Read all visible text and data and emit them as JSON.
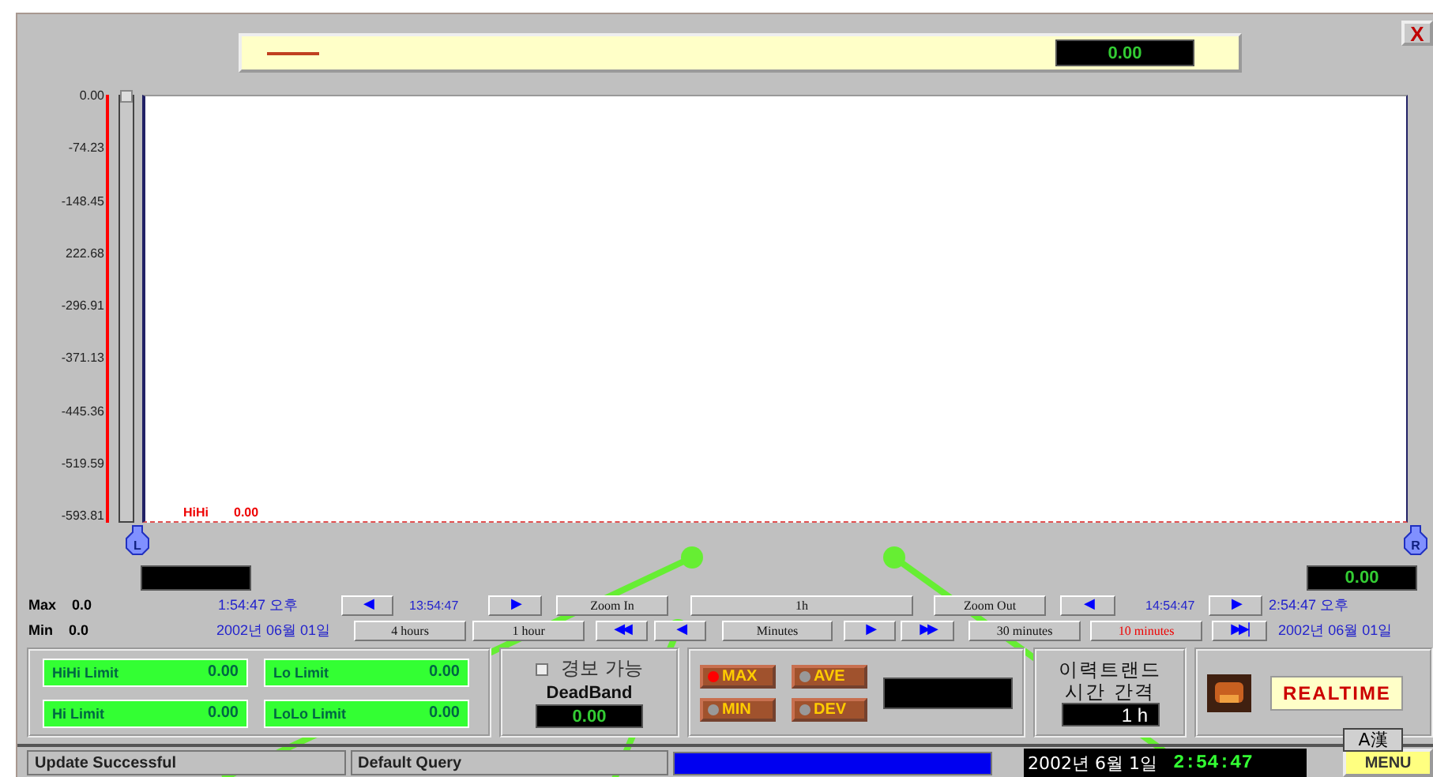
{
  "legend": {
    "value": "0.00"
  },
  "close_button": {
    "label": "X"
  },
  "y_axis": {
    "labels": [
      "0.00",
      "-74.23",
      "-148.45",
      "222.68",
      "-296.91",
      "-371.13",
      "-445.36",
      "-519.59",
      "-593.81"
    ]
  },
  "limit_line": {
    "label": "HiHi",
    "value": "0.00"
  },
  "cursors": [
    {
      "label": "L"
    },
    {
      "label": "R"
    }
  ],
  "cursor_value": "0.00",
  "summary": [
    {
      "label": "Max",
      "value": "0.0"
    },
    {
      "label": "Min",
      "value": "0.0"
    }
  ],
  "time_rows": [
    [
      {
        "kind": "text",
        "text": "1:54:47 오후"
      },
      {
        "kind": "nav",
        "text": "◀"
      },
      {
        "kind": "time",
        "text": "13:54:47"
      },
      {
        "kind": "nav",
        "text": "▶"
      },
      {
        "kind": "zoom",
        "text": "Zoom In"
      },
      {
        "kind": "zoom",
        "text": "1h"
      },
      {
        "kind": "zoom",
        "text": "Zoom Out"
      },
      {
        "kind": "nav",
        "text": "◀"
      },
      {
        "kind": "time",
        "text": "14:54:47"
      },
      {
        "kind": "nav",
        "text": "▶"
      },
      {
        "kind": "text",
        "text": "2:54:47 오후"
      }
    ],
    [
      {
        "kind": "text",
        "text": "2002년 06월 01일"
      },
      {
        "kind": "range",
        "text": "4 hours",
        "selected": false
      },
      {
        "kind": "range",
        "text": "1 hour",
        "selected": false
      },
      {
        "kind": "nav",
        "text": "◀◀"
      },
      {
        "kind": "nav",
        "text": "◀"
      },
      {
        "kind": "zoom",
        "text": "Minutes"
      },
      {
        "kind": "nav",
        "text": "▶"
      },
      {
        "kind": "nav",
        "text": "▶▶"
      },
      {
        "kind": "range",
        "text": "30 minutes",
        "selected": false
      },
      {
        "kind": "range",
        "text": "10 minutes",
        "selected": true
      },
      {
        "kind": "nav",
        "text": "▶▶|"
      },
      {
        "kind": "text",
        "text": "2002년 06월 01일"
      }
    ]
  ],
  "limits": [
    {
      "label": "HiHi Limit",
      "value": "0.00"
    },
    {
      "label": "Lo Limit",
      "value": "0.00"
    },
    {
      "label": "Hi Limit",
      "value": "0.00"
    },
    {
      "label": "LoLo Limit",
      "value": "0.00"
    }
  ],
  "alarm": {
    "label": "경보 가능",
    "checked": false,
    "deadband_label": "DeadBand",
    "deadband": "0.00"
  },
  "stats": [
    {
      "label": "MAX",
      "on": true
    },
    {
      "label": "AVE",
      "on": false
    },
    {
      "label": "MIN",
      "on": false
    },
    {
      "label": "DEV",
      "on": false
    }
  ],
  "history": {
    "title": "이력트랜드",
    "subtitle": "시간 간격",
    "interval": "1 h"
  },
  "realtime": {
    "label": "REALTIME"
  },
  "status_bar": {
    "message": "Update Successful",
    "query": "Default Query",
    "progress": {
      "level": 1
    },
    "date": "2002년 6월 1일",
    "time": "2:54:47",
    "menu": "MENU",
    "ime": "A漢"
  }
}
